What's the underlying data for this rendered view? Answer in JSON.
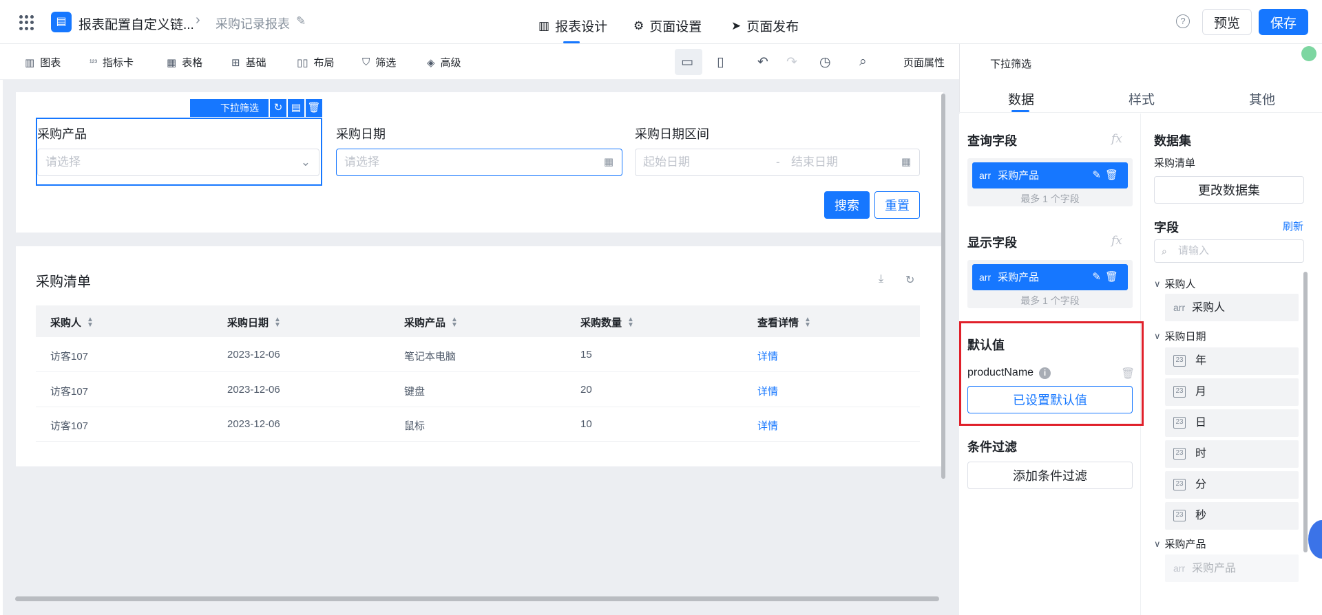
{
  "header": {
    "app_title": "报表配置自定义链...",
    "breadcrumb_current": "采购记录报表",
    "tabs": [
      {
        "label": "报表设计",
        "icon": "report-design-icon"
      },
      {
        "label": "页面设置",
        "icon": "gear-icon"
      },
      {
        "label": "页面发布",
        "icon": "send-icon"
      }
    ],
    "help_icon": "?",
    "preview_label": "预览",
    "save_label": "保存"
  },
  "toolbar": {
    "items": [
      {
        "label": "图表",
        "icon": "bar-chart-icon"
      },
      {
        "label": "指标卡",
        "icon": "metric-icon"
      },
      {
        "label": "表格",
        "icon": "table-icon"
      },
      {
        "label": "基础",
        "icon": "basic-icon"
      },
      {
        "label": "布局",
        "icon": "layout-icon"
      },
      {
        "label": "筛选",
        "icon": "filter-icon"
      },
      {
        "label": "高级",
        "icon": "layers-icon"
      }
    ],
    "page_props_label": "页面属性"
  },
  "filter": {
    "selected_tag": "下拉筛选",
    "fields": [
      {
        "label": "采购产品",
        "placeholder": "请选择"
      },
      {
        "label": "采购日期",
        "placeholder": "请选择"
      },
      {
        "label": "采购日期区间",
        "start_placeholder": "起始日期",
        "sep": "-",
        "end_placeholder": "结束日期"
      }
    ],
    "search_label": "搜索",
    "reset_label": "重置"
  },
  "table": {
    "title": "采购清单",
    "columns": [
      "采购人",
      "采购日期",
      "采购产品",
      "采购数量",
      "查看详情"
    ],
    "rows": [
      [
        "访客107",
        "2023-12-06",
        "笔记本电脑",
        "15",
        "详情"
      ],
      [
        "访客107",
        "2023-12-06",
        "键盘",
        "20",
        "详情"
      ],
      [
        "访客107",
        "2023-12-06",
        "鼠标",
        "10",
        "详情"
      ]
    ]
  },
  "panel": {
    "title": "下拉筛选",
    "tabs": [
      "数据",
      "样式",
      "其他"
    ],
    "query_field": {
      "title": "查询字段",
      "fx": "fx",
      "chip_type": "arr",
      "chip_label": "采购产品",
      "hint": "最多 1 个字段"
    },
    "display_field": {
      "title": "显示字段",
      "fx": "fx",
      "chip_type": "arr",
      "chip_label": "采购产品",
      "hint": "最多 1 个字段"
    },
    "default_value": {
      "title": "默认值",
      "param": "productName",
      "button": "已设置默认值"
    },
    "condition": {
      "title": "条件过滤",
      "button": "添加条件过滤"
    },
    "dataset": {
      "title": "数据集",
      "name": "采购清单",
      "change_button": "更改数据集"
    },
    "fields": {
      "title": "字段",
      "refresh": "刷新",
      "search_placeholder": "请输入",
      "groups": [
        {
          "name": "采购人",
          "items": [
            {
              "type": "arr",
              "label": "采购人"
            }
          ]
        },
        {
          "name": "采购日期",
          "items": [
            {
              "type": "date",
              "label": "年"
            },
            {
              "type": "date",
              "label": "月"
            },
            {
              "type": "date",
              "label": "日"
            },
            {
              "type": "date",
              "label": "时"
            },
            {
              "type": "date",
              "label": "分"
            },
            {
              "type": "date",
              "label": "秒"
            }
          ]
        },
        {
          "name": "采购产品",
          "items": [
            {
              "type": "arr",
              "label": "采购产品"
            }
          ]
        }
      ]
    }
  },
  "colors": {
    "primary": "#1677ff",
    "highlight": "#e0202a",
    "canvas_bg": "#eceef2"
  }
}
